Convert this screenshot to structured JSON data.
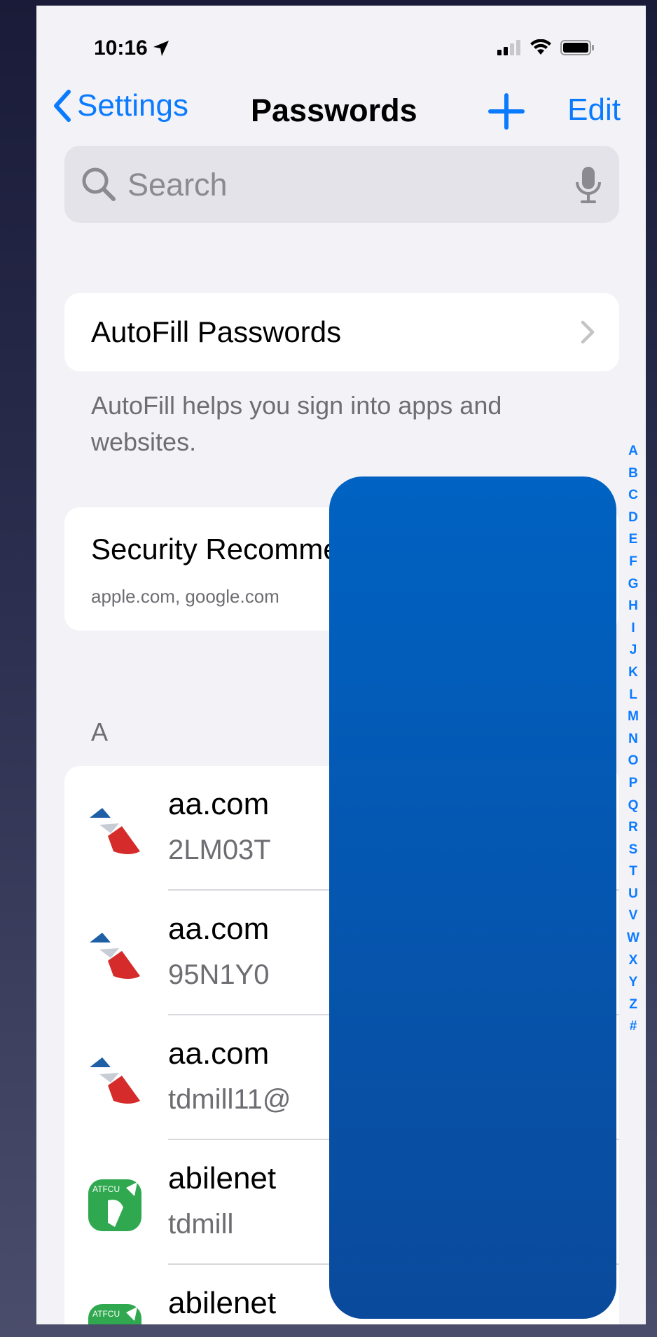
{
  "status_bar": {
    "time": "10:16"
  },
  "nav": {
    "back_label": "Settings",
    "title": "Passwords",
    "edit_label": "Edit"
  },
  "search": {
    "placeholder": "Search"
  },
  "autofill": {
    "title": "AutoFill Passwords",
    "footnote": "AutoFill helps you sign into apps and websites."
  },
  "security": {
    "title": "Security Recommendations",
    "subtitle": "apple.com, google.com"
  },
  "list": {
    "section": "A",
    "items": [
      {
        "title": "aa.com",
        "user": "2LM03T",
        "icon": "american-airlines-logo"
      },
      {
        "title": "aa.com",
        "user": "95N1Y0",
        "icon": "american-airlines-logo"
      },
      {
        "title": "aa.com",
        "user": "tdmill11@",
        "icon": "american-airlines-logo"
      },
      {
        "title": "abilenet",
        "user": "tdmill",
        "icon": "atfcu-logo"
      },
      {
        "title": "abilenet",
        "user": "",
        "icon": "atfcu-logo"
      }
    ]
  },
  "index_letters": [
    "A",
    "B",
    "C",
    "D",
    "E",
    "F",
    "G",
    "H",
    "I",
    "J",
    "K",
    "L",
    "M",
    "N",
    "O",
    "P",
    "Q",
    "R",
    "S",
    "T",
    "U",
    "V",
    "W",
    "X",
    "Y",
    "Z",
    "#"
  ],
  "colors": {
    "accent": "#0a7aff",
    "background": "#f2f2f7",
    "redaction": "#0a5bb5"
  }
}
